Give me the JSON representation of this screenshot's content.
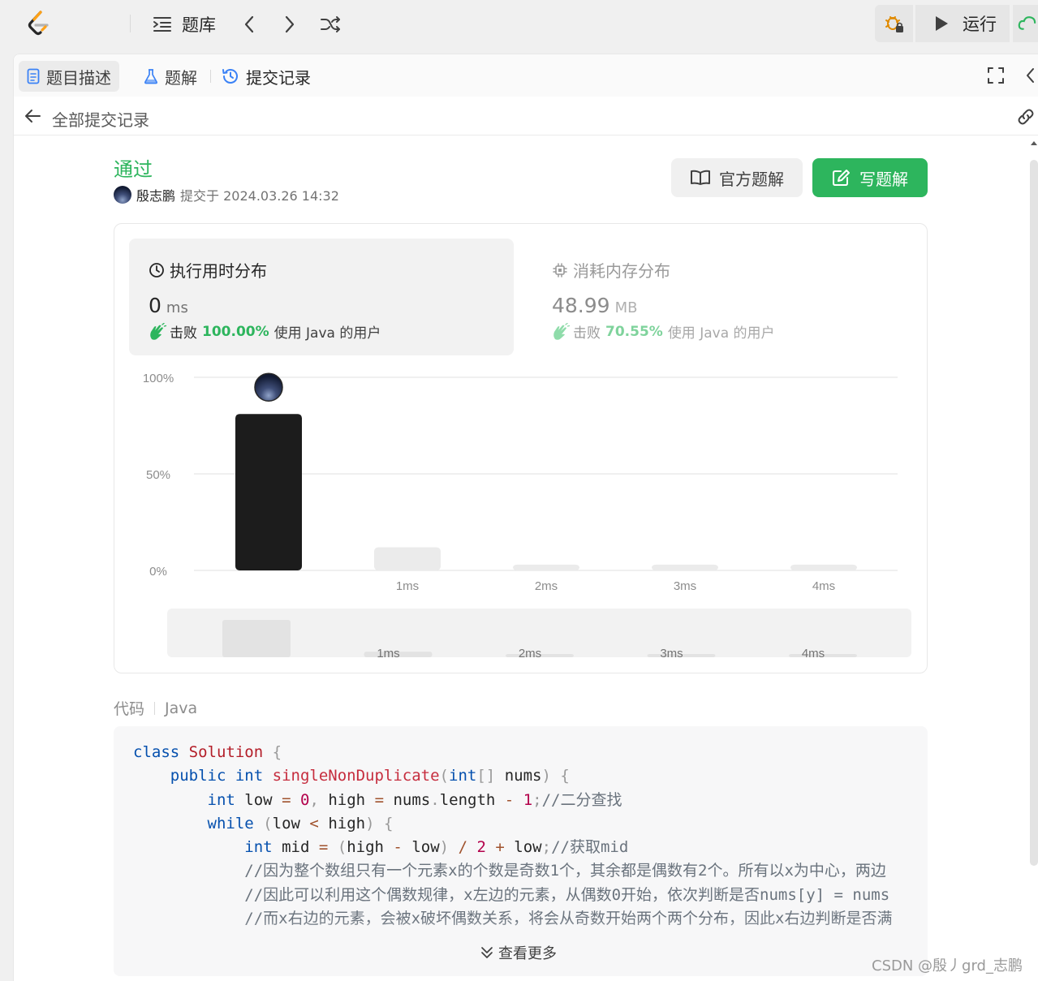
{
  "topbar": {
    "problem_bank_label": "题库",
    "run_label": "运行"
  },
  "tabs": [
    {
      "label": "题目描述"
    },
    {
      "label": "题解"
    },
    {
      "label": "提交记录"
    }
  ],
  "subheader": {
    "back_label": "全部提交记录"
  },
  "submission": {
    "status": "通过",
    "user": "殷志鹏",
    "submitted": "提交于 2024.03.26 14:32",
    "official_solution_label": "官方题解",
    "write_solution_label": "写题解"
  },
  "runtime": {
    "title": "执行用时分布",
    "value": "0",
    "unit": "ms",
    "beat_label": "击败",
    "percent": "100.00%",
    "users_label": "使用 Java 的用户"
  },
  "memory": {
    "title": "消耗内存分布",
    "value": "48.99",
    "unit": "MB",
    "beat_label": "击败",
    "percent": "70.55%",
    "users_label": "使用 Java 的用户"
  },
  "chart_data": {
    "type": "bar",
    "categories": [
      "0ms",
      "1ms",
      "2ms",
      "3ms",
      "4ms"
    ],
    "tick_labels": [
      "",
      "1ms",
      "2ms",
      "3ms",
      "4ms"
    ],
    "values": [
      81,
      12,
      3,
      3,
      3
    ],
    "highlight_index": 0,
    "y_ticks": [
      "100%",
      "50%",
      "0%"
    ],
    "ylim": [
      0,
      100
    ],
    "grid": true,
    "overview_values": [
      100,
      15,
      4,
      4,
      4
    ],
    "colors": {
      "highlight": "#1c1c1c",
      "bar": "#ebebeb",
      "grid": "#e6e6e6"
    }
  },
  "code": {
    "label": "代码",
    "language": "Java",
    "lines": [
      "class Solution {",
      "    public int singleNonDuplicate(int[] nums) {",
      "        int low = 0, high = nums.length - 1;//二分查找",
      "        while (low < high) {",
      "            int mid = (high - low) / 2 + low;//获取mid",
      "            //因为整个数组只有一个元素x的个数是奇数1个，其余都是偶数有2个。所有以x为中心，两边",
      "            //因此可以利用这个偶数规律，x左边的元素，从偶数0开始，依次判断是否nums[y] = nums",
      "            //而x右边的元素，会被x破坏偶数关系，将会从奇数开始两个两个分布，因此x右边判断是否满"
    ],
    "more_label": "查看更多"
  },
  "watermark": "CSDN @殷丿grd_志鹏"
}
